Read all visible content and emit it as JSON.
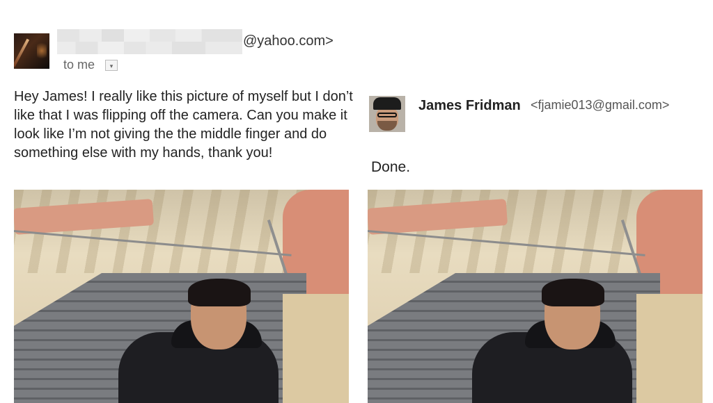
{
  "email": {
    "sender_domain": "@yahoo.com>",
    "to_me_label": "to me",
    "dropdown_glyph": "▾",
    "body": "Hey James! I really like this picture of myself but I don’t like that I was flipping off the camera. Can you make it look like I’m not giving the the middle finger and do something else with my hands, thank you!"
  },
  "reply": {
    "name": "James Fridman",
    "email": "<fjamie013@gmail.com>",
    "text": "Done."
  },
  "icons": {
    "dropdown": "chevron-down-icon"
  }
}
